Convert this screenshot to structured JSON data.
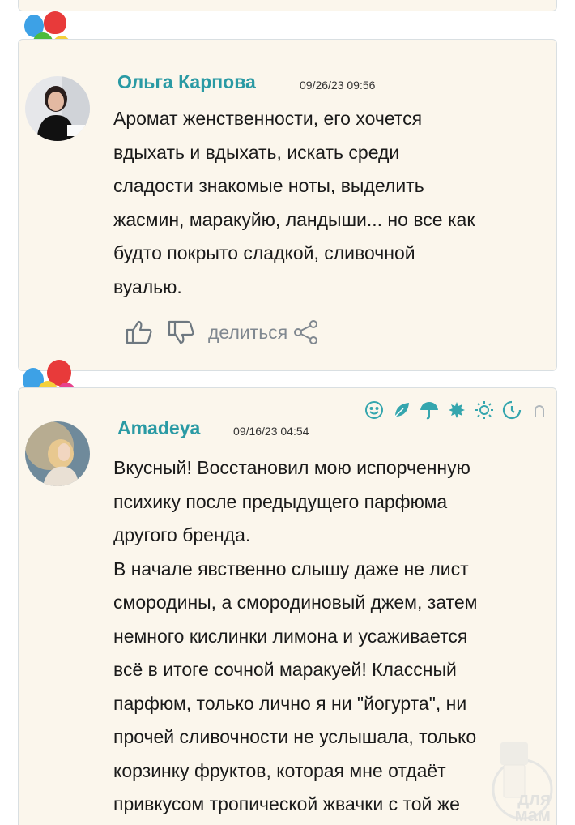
{
  "reviews": [
    {
      "author": "Ольга Карпова",
      "date": "09/26/23 09:56",
      "lines": [
        "Аромат женственности, его хочется",
        "вдыхать и вдыхать, искать среди",
        "сладости знакомые ноты, выделить",
        "жасмин, маракуйю, ландыши... но все как",
        "будто покрыто сладкой, сливочной",
        "вуалью."
      ],
      "share_label": "делиться"
    },
    {
      "author": "Amadeya",
      "date": "09/16/23 04:54",
      "lines": [
        "Вкусный! Восстановил мою испорченную",
        "психику после предыдущего парфюма",
        "другого бренда.",
        "В начале явственно слышу даже не лист",
        "смородины, а смородиновый джем, затем",
        "немного кислинки лимона и усаживается",
        "всё в итоге сочной маракуей! Классный",
        "парфюм, только лично я ни \"йогурта\", ни",
        "прочей сливочности не услышала, только",
        "корзинку фруктов, которая мне отдаёт",
        "привкусом тропической жвачки с той же"
      ],
      "note_icons": [
        "smiley-icon",
        "leaf-icon",
        "umbrella-icon",
        "maple-leaf-icon",
        "sun-icon",
        "day-night-icon",
        "moon-icon"
      ]
    }
  ],
  "watermark": {
    "line1": "для",
    "line2": "мам"
  },
  "colors": {
    "author": "#2a9aa4",
    "card_bg": "#fbf6ec",
    "icon": "#35a6ae"
  }
}
